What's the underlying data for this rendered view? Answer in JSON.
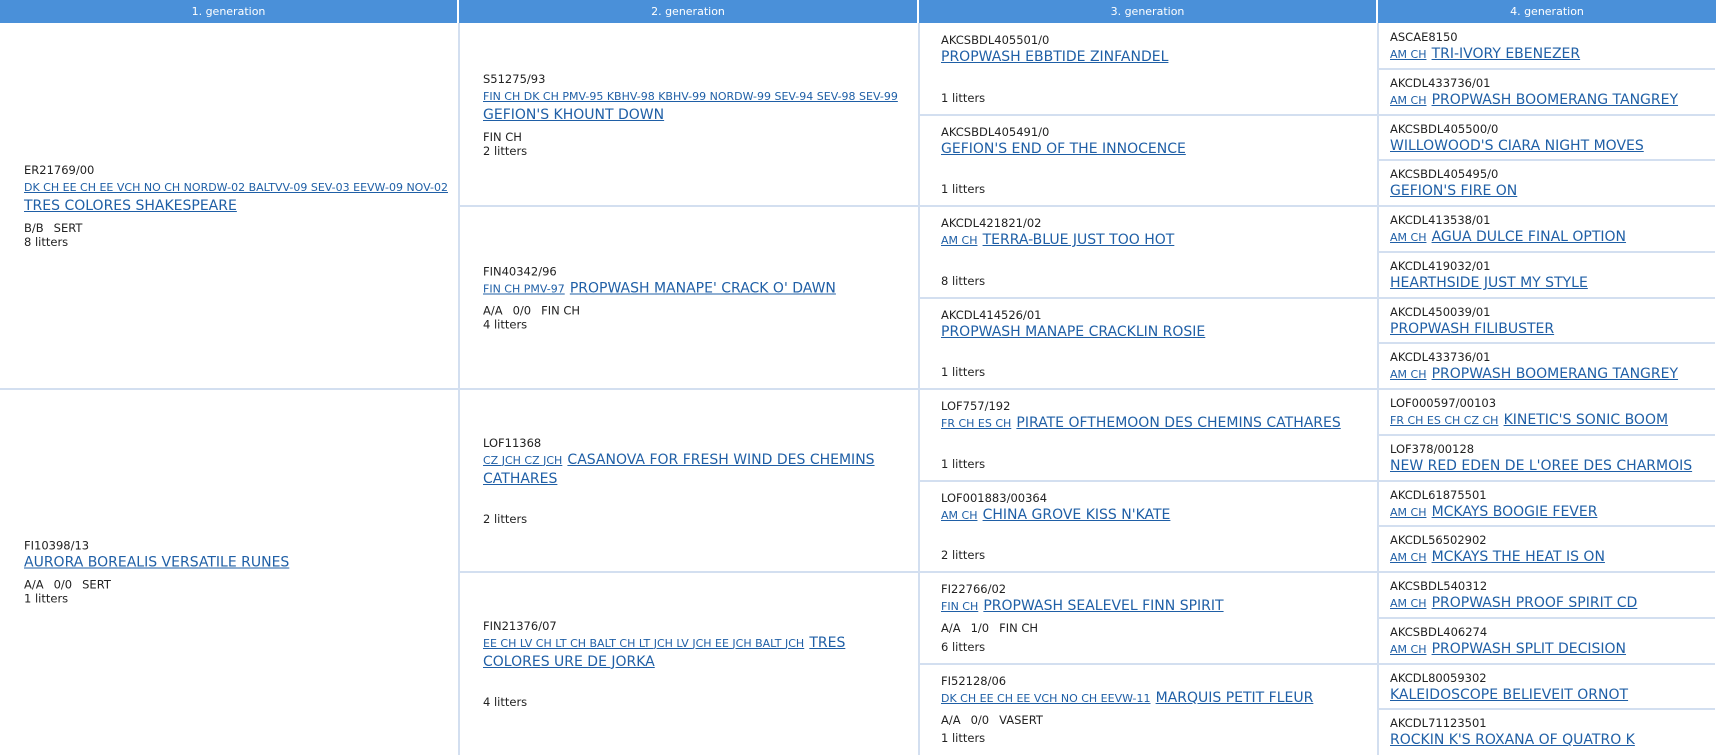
{
  "headers": [
    "1. generation",
    "2. generation",
    "3. generation",
    "4. generation"
  ],
  "gen1": [
    {
      "reg": "ER21769/00",
      "titles": "DK CH EE CH EE VCH NO CH NORDW-02 BALTVV-09 SEV-03 EEVW-09 NOV-02",
      "name": "TRES COLORES SHAKESPEARE",
      "info": [
        "B/B",
        "SERT"
      ],
      "litters": "8 litters"
    },
    {
      "reg": "FI10398/13",
      "titles": "",
      "name": "AURORA BOREALIS VERSATILE RUNES",
      "info": [
        "A/A",
        "0/0",
        "SERT"
      ],
      "litters": "1 litters"
    }
  ],
  "gen2": [
    {
      "reg": "S51275/93",
      "titles": "FIN CH DK CH PMV-95 KBHV-98 KBHV-99 NORDW-99 SEV-94 SEV-98 SEV-99",
      "name": "GEFION'S KHOUNT DOWN",
      "info": [
        "FIN CH"
      ],
      "litters": "2 litters"
    },
    {
      "reg": "FIN40342/96",
      "titles": "FIN CH PMV-97",
      "name": "PROPWASH MANAPE' CRACK O' DAWN",
      "info": [
        "A/A",
        "0/0",
        "FIN CH"
      ],
      "litters": "4 litters"
    },
    {
      "reg": "LOF11368",
      "titles": "CZ JCH CZ JCH",
      "name": "CASANOVA FOR FRESH WIND DES CHEMINS CATHARES",
      "info": [],
      "litters": "2 litters"
    },
    {
      "reg": "FIN21376/07",
      "titles": "EE CH LV CH LT CH BALT CH LT JCH LV JCH EE JCH BALT JCH",
      "name": "TRES COLORES URE DE JORKA",
      "info": [],
      "litters": "4 litters"
    }
  ],
  "gen3": [
    {
      "reg": "AKCSBDL405501/0",
      "titles": "",
      "name": "PROPWASH EBBTIDE ZINFANDEL",
      "info": [],
      "litters": "1 litters"
    },
    {
      "reg": "AKCSBDL405491/0",
      "titles": "",
      "name": "GEFION'S END OF THE INNOCENCE",
      "info": [],
      "litters": "1 litters"
    },
    {
      "reg": "AKCDL421821/02",
      "titles": "AM CH",
      "name": "TERRA-BLUE JUST TOO HOT",
      "info": [],
      "litters": "8 litters"
    },
    {
      "reg": "AKCDL414526/01",
      "titles": "",
      "name": "PROPWASH MANAPE CRACKLIN ROSIE",
      "info": [],
      "litters": "1 litters"
    },
    {
      "reg": "LOF757/192",
      "titles": "FR CH ES CH",
      "name": "PIRATE OFTHEMOON DES CHEMINS CATHARES",
      "info": [],
      "litters": "1 litters"
    },
    {
      "reg": "LOF001883/00364",
      "titles": "AM CH",
      "name": "CHINA GROVE KISS N'KATE",
      "info": [],
      "litters": "2 litters"
    },
    {
      "reg": "FI22766/02",
      "titles": "FIN CH",
      "name": "PROPWASH SEALEVEL FINN SPIRIT",
      "info": [
        "A/A",
        "1/0",
        "FIN CH"
      ],
      "litters": "6 litters"
    },
    {
      "reg": "FI52128/06",
      "titles": "DK CH EE CH EE VCH NO CH EEVW-11",
      "name": "MARQUIS PETIT FLEUR",
      "info": [
        "A/A",
        "0/0",
        "VASERT"
      ],
      "litters": "1 litters"
    }
  ],
  "gen4": [
    {
      "reg": "ASCAE8150",
      "titles": "AM CH",
      "name": "TRI-IVORY EBENEZER"
    },
    {
      "reg": "AKCDL433736/01",
      "titles": "AM CH",
      "name": "PROPWASH BOOMERANG TANGREY"
    },
    {
      "reg": "AKCSBDL405500/0",
      "titles": "",
      "name": "WILLOWOOD'S CIARA NIGHT MOVES"
    },
    {
      "reg": "AKCSBDL405495/0",
      "titles": "",
      "name": "GEFION'S FIRE ON"
    },
    {
      "reg": "AKCDL413538/01",
      "titles": "AM CH",
      "name": "AGUA DULCE FINAL OPTION"
    },
    {
      "reg": "AKCDL419032/01",
      "titles": "",
      "name": "HEARTHSIDE JUST MY STYLE"
    },
    {
      "reg": "AKCDL450039/01",
      "titles": "",
      "name": "PROPWASH FILIBUSTER"
    },
    {
      "reg": "AKCDL433736/01",
      "titles": "AM CH",
      "name": "PROPWASH BOOMERANG TANGREY"
    },
    {
      "reg": "LOF000597/00103",
      "titles": "FR CH ES CH CZ CH",
      "name": "KINETIC'S SONIC BOOM"
    },
    {
      "reg": "LOF378/00128",
      "titles": "",
      "name": "NEW RED EDEN DE L'OREE DES CHARMOIS"
    },
    {
      "reg": "AKCDL61875501",
      "titles": "AM CH",
      "name": "MCKAYS BOOGIE FEVER"
    },
    {
      "reg": "AKCDL56502902",
      "titles": "AM CH",
      "name": "MCKAYS THE HEAT IS ON"
    },
    {
      "reg": "AKCSBDL540312",
      "titles": "AM CH",
      "name": "PROPWASH PROOF SPIRIT CD"
    },
    {
      "reg": "AKCSBDL406274",
      "titles": "AM CH",
      "name": "PROPWASH SPLIT DECISION"
    },
    {
      "reg": "AKCDL80059302",
      "titles": "",
      "name": "KALEIDOSCOPE BELIEVEIT ORNOT"
    },
    {
      "reg": "AKCDL71123501",
      "titles": "",
      "name": "ROCKIN K'S ROXANA OF QUATRO K"
    }
  ]
}
